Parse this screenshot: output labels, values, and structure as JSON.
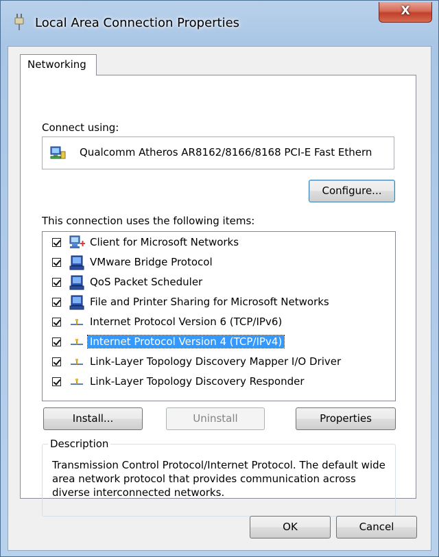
{
  "window": {
    "title": "Local Area Connection Properties",
    "close_label": "X"
  },
  "tabs": [
    {
      "label": "Networking",
      "selected": true
    }
  ],
  "connect": {
    "label": "Connect using:",
    "adapter_name": "Qualcomm Atheros AR8162/8166/8168 PCI-E Fast Ethern",
    "configure_label": "Configure..."
  },
  "items_section": {
    "label": "This connection uses the following items:",
    "items": [
      {
        "label": "Client for Microsoft Networks",
        "checked": true,
        "icon": "network-client-icon"
      },
      {
        "label": "VMware Bridge Protocol",
        "checked": true,
        "icon": "network-service-icon"
      },
      {
        "label": "QoS Packet Scheduler",
        "checked": true,
        "icon": "network-service-icon"
      },
      {
        "label": "File and Printer Sharing for Microsoft Networks",
        "checked": true,
        "icon": "network-service-icon"
      },
      {
        "label": "Internet Protocol Version 6 (TCP/IPv6)",
        "checked": true,
        "icon": "network-protocol-icon"
      },
      {
        "label": "Internet Protocol Version 4 (TCP/IPv4)",
        "checked": true,
        "icon": "network-protocol-icon",
        "selected": true
      },
      {
        "label": "Link-Layer Topology Discovery Mapper I/O Driver",
        "checked": true,
        "icon": "network-protocol-icon"
      },
      {
        "label": "Link-Layer Topology Discovery Responder",
        "checked": true,
        "icon": "network-protocol-icon"
      }
    ]
  },
  "actions": {
    "install_label": "Install...",
    "uninstall_label": "Uninstall",
    "uninstall_disabled": true,
    "properties_label": "Properties"
  },
  "description": {
    "legend": "Description",
    "text": "Transmission Control Protocol/Internet Protocol. The default wide area network protocol that provides communication across diverse interconnected networks."
  },
  "footer": {
    "ok_label": "OK",
    "cancel_label": "Cancel"
  },
  "colors": {
    "selection": "#3399ff",
    "close_button": "#c2402b",
    "window_frame": "#b9d1ea"
  }
}
